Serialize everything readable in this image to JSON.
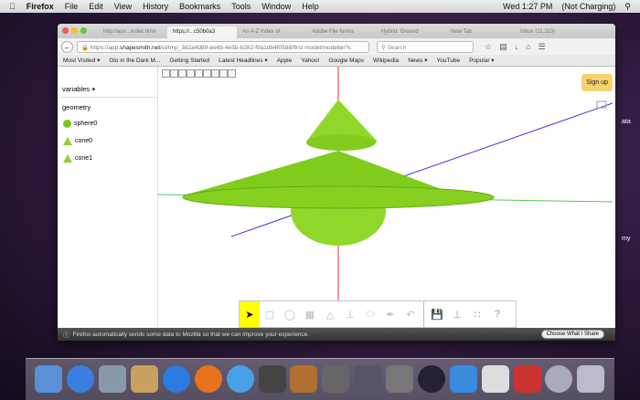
{
  "menubar": {
    "app": "Firefox",
    "items": [
      "File",
      "Edit",
      "View",
      "History",
      "Bookmarks",
      "Tools",
      "Window",
      "Help"
    ],
    "clock": "Wed 1:27 PM",
    "battery": "(Not Charging)"
  },
  "tabs": [
    "http://ace...index.html",
    "https://...c50b0a3",
    "An A-Z Index of",
    "Adobe File forma",
    "Hybrid: Ground",
    "New Tab",
    "Inbox (11,110)"
  ],
  "url": {
    "prefix": "https://app.",
    "domain": "shapesmith.net",
    "path": "/ui/tmp_3d2a4d89-ee6b-4e5b-b282-f9a1db4f0588/first model/modeller?c"
  },
  "search_placeholder": "Search",
  "bookmarks": [
    "Most Visited ▾",
    "Glo in the Dark M...",
    "Getting Started",
    "Latest Headlines ▾",
    "Apple",
    "Yahoo!",
    "Google Maps",
    "Wikipedia",
    "News ▾",
    "YouTube",
    "Popular ▾"
  ],
  "sidebar": {
    "variables": "variables",
    "add": "+",
    "geometry": "geometry",
    "items": [
      "sphere0",
      "cone0",
      "cone1"
    ]
  },
  "signup": "Sign up",
  "toolbar": {
    "icons": [
      "pointer",
      "cube",
      "sphere",
      "cylinder",
      "cone",
      "stl-import",
      "ellipse",
      "pen",
      "undo",
      "save",
      "stl-export",
      "grid",
      "help"
    ],
    "help": "?"
  },
  "notification": {
    "text": "Firefox automatically sends some data to Mozilla so that we can improve your experience.",
    "button": "Choose What I Share"
  },
  "desktop": {
    "labels": [
      "ata",
      "my"
    ]
  },
  "colors": {
    "shape": "#7bc423",
    "signup": "#f6d36e",
    "selected_tool": "#ffff00"
  }
}
